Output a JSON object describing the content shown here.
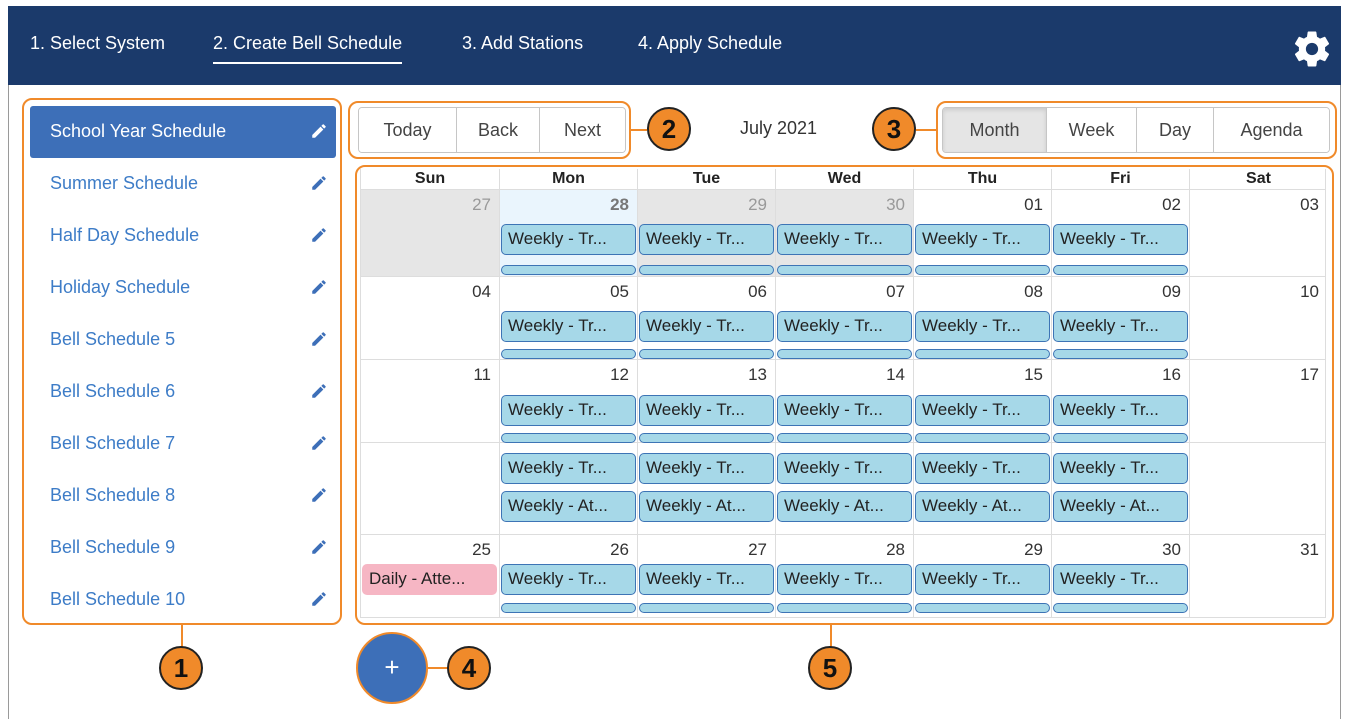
{
  "nav": {
    "tabs": [
      {
        "label": "1. Select System"
      },
      {
        "label": "2. Create Bell Schedule"
      },
      {
        "label": "3. Add Stations"
      },
      {
        "label": "4. Apply Schedule"
      }
    ],
    "active_tab": 1,
    "settings_icon": "gear-icon"
  },
  "sidebar": {
    "items": [
      {
        "label": "School Year Schedule"
      },
      {
        "label": "Summer Schedule"
      },
      {
        "label": "Half Day Schedule"
      },
      {
        "label": "Holiday Schedule"
      },
      {
        "label": "Bell Schedule 5"
      },
      {
        "label": "Bell Schedule 6"
      },
      {
        "label": "Bell Schedule 7"
      },
      {
        "label": "Bell Schedule 8"
      },
      {
        "label": "Bell Schedule 9"
      },
      {
        "label": "Bell Schedule 10"
      }
    ],
    "active_index": 0,
    "edit_icon": "pencil-icon"
  },
  "toolbar": {
    "today": "Today",
    "back": "Back",
    "next": "Next",
    "title": "July 2021",
    "views": [
      "Month",
      "Week",
      "Day",
      "Agenda"
    ],
    "active_view": "Month"
  },
  "calendar": {
    "weekdays": [
      "Sun",
      "Mon",
      "Tue",
      "Wed",
      "Thu",
      "Fri",
      "Sat"
    ],
    "weeks": [
      {
        "days": [
          "27",
          "28",
          "29",
          "30",
          "01",
          "02",
          "03"
        ]
      },
      {
        "days": [
          "04",
          "05",
          "06",
          "07",
          "08",
          "09",
          "10"
        ]
      },
      {
        "days": [
          "11",
          "12",
          "13",
          "14",
          "15",
          "16",
          "17"
        ]
      },
      {
        "days": [
          "",
          "",
          "",
          "",
          "",
          "",
          ""
        ]
      },
      {
        "days": [
          "25",
          "26",
          "27",
          "28",
          "29",
          "30",
          "31"
        ]
      }
    ],
    "event_weekly_tr": "Weekly - Tr...",
    "event_weekly_at": "Weekly - At...",
    "event_daily_att": "Daily - Atte..."
  },
  "add_button": {
    "label": "+"
  },
  "callouts": [
    "1",
    "2",
    "3",
    "4",
    "5"
  ],
  "colors": {
    "nav_bg": "#1b3a6b",
    "accent_orange": "#f08a2a",
    "primary_blue": "#3d6fb8",
    "link_blue": "#3d7cc7",
    "event_blue": "#a6d8e8",
    "event_pink": "#f6b6c4"
  }
}
